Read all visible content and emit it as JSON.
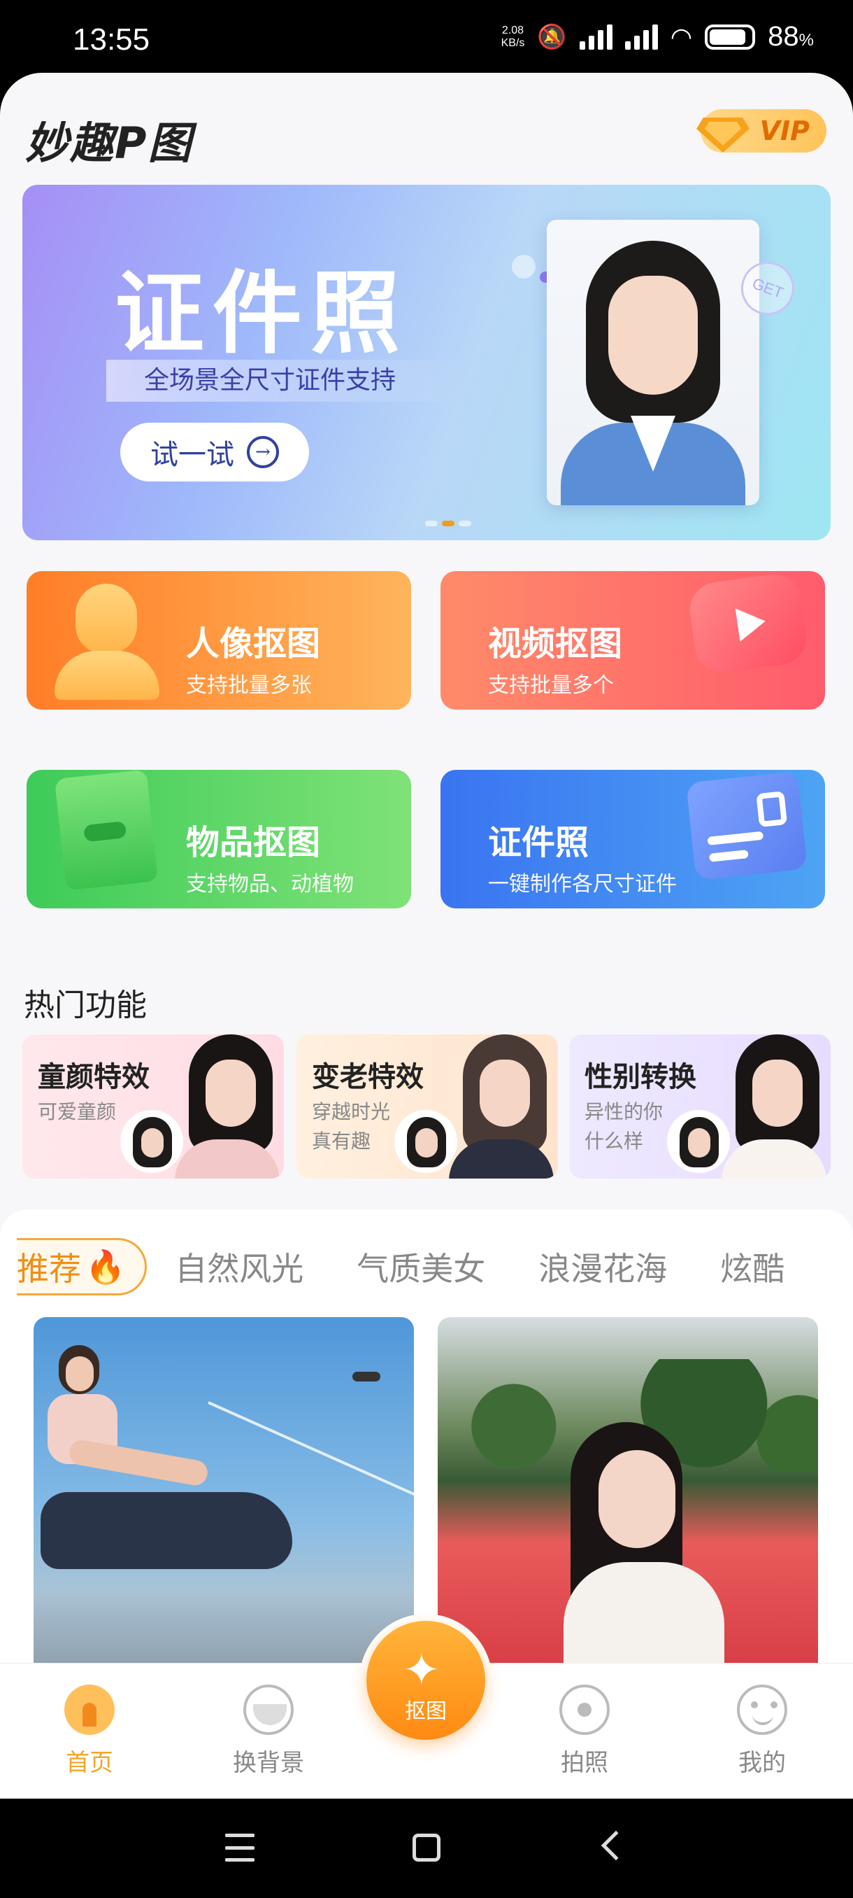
{
  "status_bar": {
    "time": "13:55",
    "net_speed": "2.08",
    "net_unit": "KB/s",
    "battery": "88",
    "battery_unit": "%"
  },
  "header": {
    "logo_text": "妙趣P图",
    "vip_label": "VIP"
  },
  "banner": {
    "title": "证件照",
    "subtitle": "全场景全尺寸证件支持",
    "button_label": "试一试",
    "badge": "GET",
    "page_indicator": {
      "current": 2,
      "total": 3
    }
  },
  "features": [
    {
      "title": "人像抠图",
      "subtitle": "支持批量多张",
      "icon": "person-icon"
    },
    {
      "title": "视频抠图",
      "subtitle": "支持批量多个",
      "icon": "play-icon"
    },
    {
      "title": "物品抠图",
      "subtitle": "支持物品、动植物",
      "icon": "box-icon"
    },
    {
      "title": "证件照",
      "subtitle": "一键制作各尺寸证件",
      "icon": "id-card-icon"
    }
  ],
  "hot": {
    "title": "热门功能",
    "items": [
      {
        "title": "童颜特效",
        "subtitle": "可爱童颜"
      },
      {
        "title": "变老特效",
        "subtitle": "穿越时光真有趣"
      },
      {
        "title": "性别转换",
        "subtitle": "异性的你什么样"
      }
    ]
  },
  "tabs": {
    "items": [
      "推荐",
      "自然风光",
      "气质美女",
      "浪漫花海",
      "炫酷"
    ],
    "active_index": 0,
    "active_emoji": "🔥"
  },
  "bottom_nav": {
    "items": [
      "首页",
      "换背景",
      "抠图",
      "拍照",
      "我的"
    ],
    "active_index": 0
  },
  "colors": {
    "accent": "#f4a52a",
    "active_tab": "#ef8e14"
  }
}
